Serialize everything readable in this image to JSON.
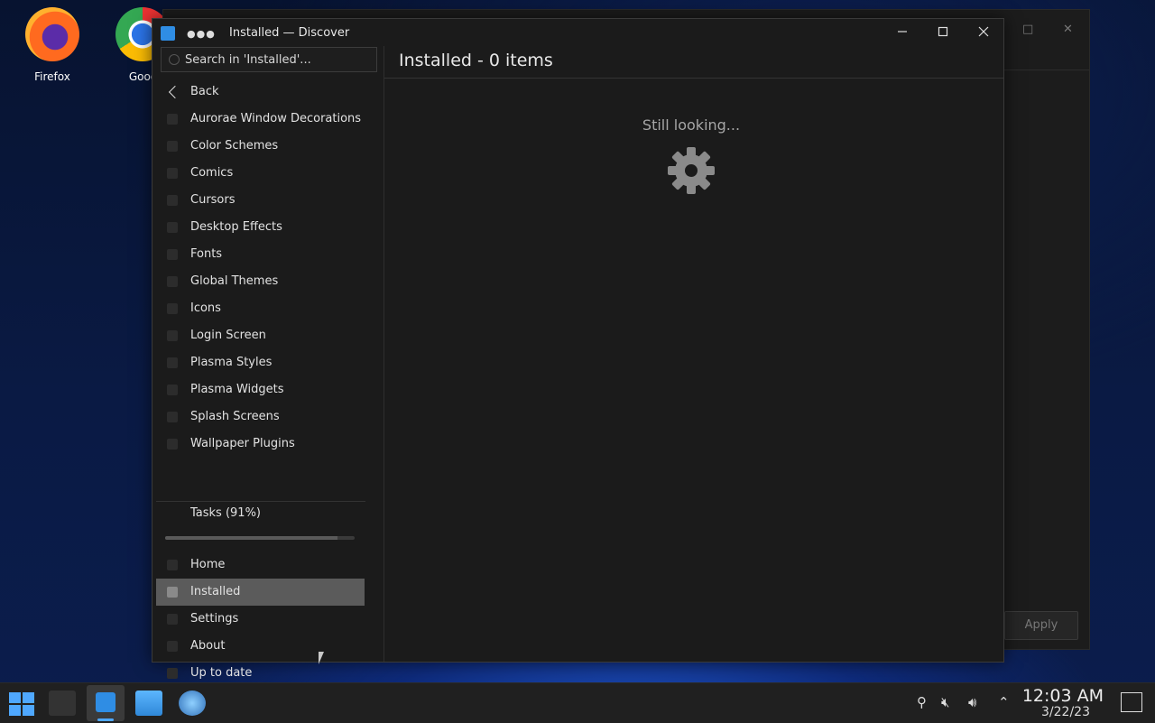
{
  "desktop": {
    "icons": [
      {
        "label": "Firefox"
      },
      {
        "label": "Google"
      }
    ]
  },
  "background_window": {
    "apply_label": "Apply"
  },
  "window": {
    "title": "Installed — Discover",
    "menu_dots": "●●●"
  },
  "search": {
    "placeholder": "Search in 'Installed'..."
  },
  "sidebar": {
    "back_label": "Back",
    "categories": [
      "Aurorae Window Decorations",
      "Color Schemes",
      "Comics",
      "Cursors",
      "Desktop Effects",
      "Fonts",
      "Global Themes",
      "Icons",
      "Login Screen",
      "Plasma Styles",
      "Plasma Widgets",
      "Splash Screens",
      "Wallpaper Plugins"
    ],
    "tasks_label": "Tasks (91%)",
    "tasks_progress": 0.91,
    "bottom_items": [
      "Home",
      "Installed",
      "Settings",
      "About",
      "Up to date"
    ],
    "active_item": "Installed"
  },
  "content": {
    "title": "Installed - 0 items",
    "status": "Still looking..."
  },
  "taskbar": {
    "time": "12:03 AM",
    "date": "3/22/23"
  },
  "colors": {
    "accent": "#4fa8ff",
    "window_bg": "#1b1b1b",
    "active_item_bg": "#5b5b5b"
  }
}
